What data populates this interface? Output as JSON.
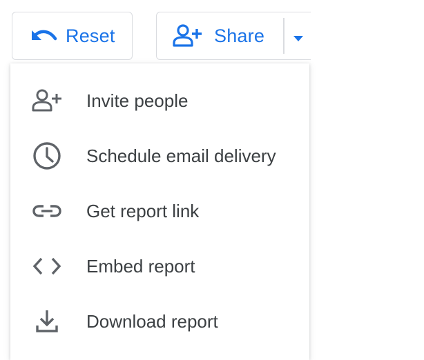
{
  "toolbar": {
    "reset_label": "Reset",
    "share_label": "Share"
  },
  "colors": {
    "accent": "#1a73e8",
    "menu_text": "#3c4043",
    "menu_icon": "#5f6368",
    "border": "#dadce0"
  },
  "menu": {
    "items": [
      {
        "label": "Invite people",
        "icon": "person-add-icon"
      },
      {
        "label": "Schedule email delivery",
        "icon": "clock-icon"
      },
      {
        "label": "Get report link",
        "icon": "link-icon"
      },
      {
        "label": "Embed report",
        "icon": "code-icon"
      },
      {
        "label": "Download report",
        "icon": "download-icon"
      }
    ]
  }
}
